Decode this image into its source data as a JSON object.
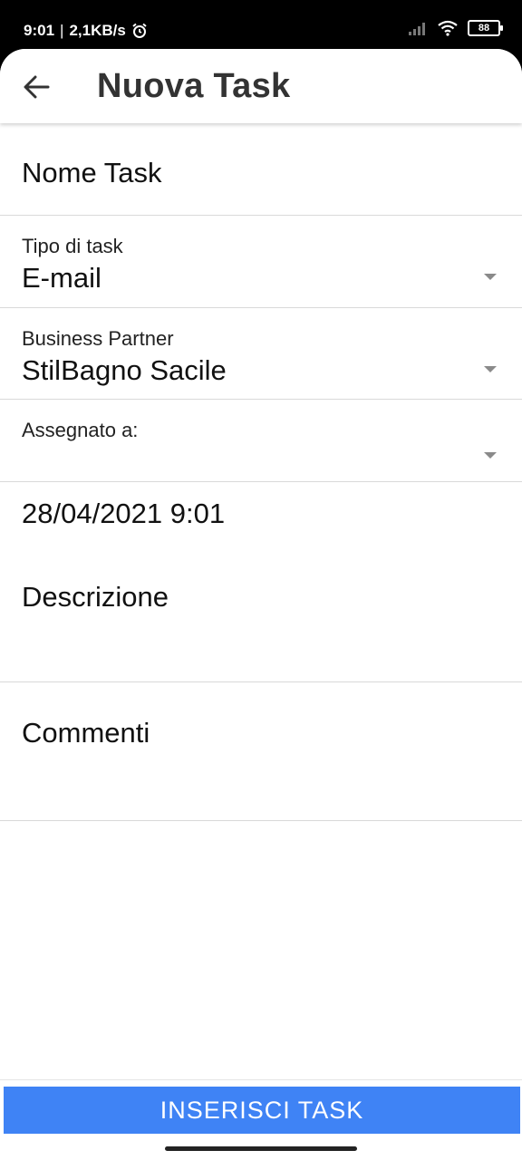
{
  "status_bar": {
    "time": "9:01",
    "separator": "|",
    "network_speed": "2,1KB/s",
    "battery": "88",
    "icons": [
      "alarm-icon",
      "signal-icon",
      "wifi-icon",
      "battery-icon"
    ]
  },
  "app_bar": {
    "back_icon": "arrow-left-icon",
    "title": "Nuova Task"
  },
  "form": {
    "nome_task": {
      "placeholder": "Nome Task"
    },
    "tipo_task": {
      "label": "Tipo di task",
      "value": "E-mail"
    },
    "business_partner": {
      "label": "Business Partner",
      "value": "StilBagno Sacile"
    },
    "assegnato": {
      "label": "Assegnato a:",
      "value": ""
    },
    "datetime": {
      "value": "28/04/2021 9:01"
    },
    "descrizione": {
      "placeholder": "Descrizione"
    },
    "commenti": {
      "placeholder": "Commenti"
    }
  },
  "actions": {
    "submit_label": "INSERISCI TASK"
  },
  "colors": {
    "primary": "#3f83f5",
    "divider": "#d9d9d9",
    "dropdown_arrow": "#8a8a8a"
  }
}
